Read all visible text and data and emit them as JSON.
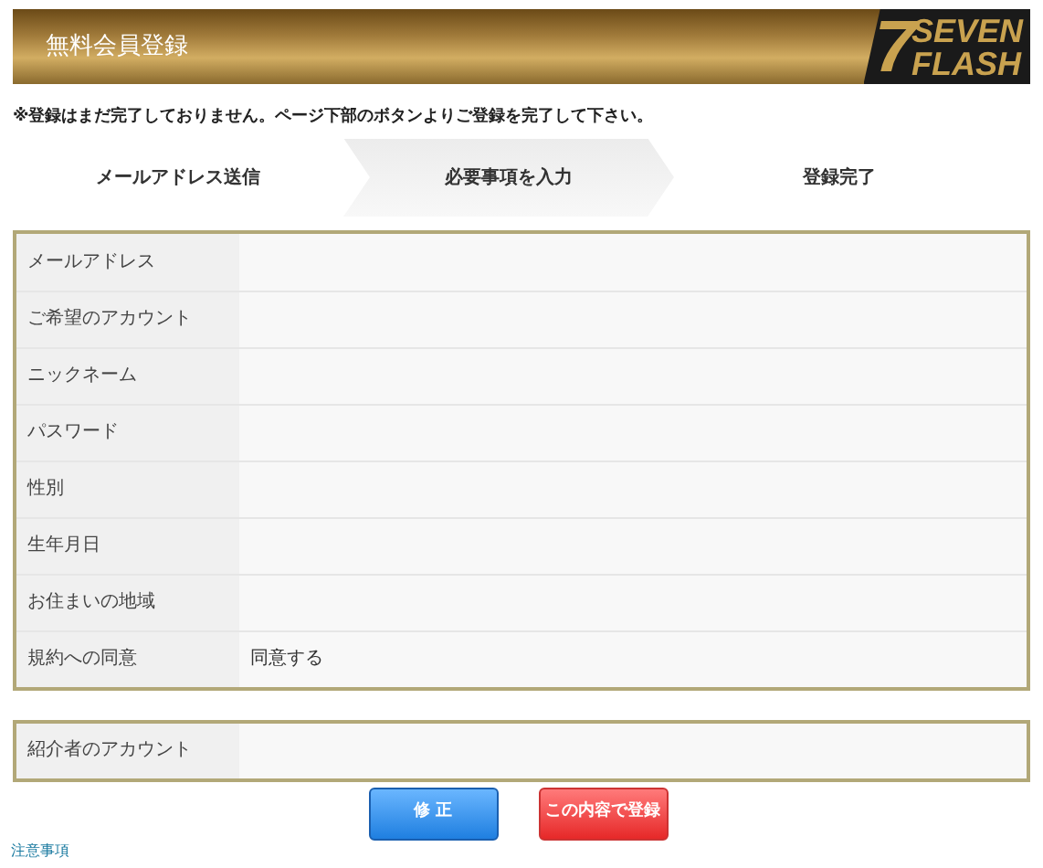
{
  "header": {
    "title": "無料会員登録",
    "logo_mark": "7",
    "logo_lines": [
      "SEVEN",
      "FLASH"
    ]
  },
  "notice": "※登録はまだ完了しておりません。ページ下部のボタンよりご登録を完了して下さい。",
  "steps": [
    {
      "label": "メールアドレス送信",
      "selected": false
    },
    {
      "label": "必要事項を入力",
      "selected": true
    },
    {
      "label": "登録完了",
      "selected": false
    }
  ],
  "form": [
    {
      "label": "メールアドレス"
    },
    {
      "label": "ご希望のアカウント"
    },
    {
      "label": "ニックネーム"
    },
    {
      "label": "パスワード"
    },
    {
      "label": "性別"
    },
    {
      "label": "生年月日"
    },
    {
      "label": "お住まいの地域"
    },
    {
      "label": "規約への同意",
      "value": "同意する"
    }
  ],
  "referrer": {
    "label": "紹介者のアカウント"
  },
  "buttons": [
    {
      "label": "修 正",
      "kind": "edit"
    },
    {
      "label": "この内容で登録",
      "kind": "submit"
    }
  ],
  "footer_link": "注意事項"
}
